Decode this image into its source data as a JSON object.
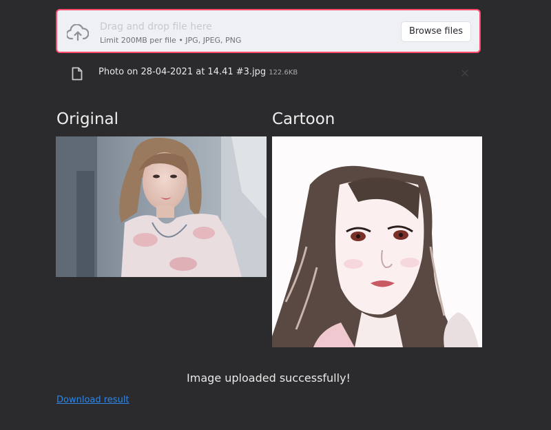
{
  "uploader": {
    "title": "Drag and drop file here",
    "limit_text": "Limit 200MB per file • JPG, JPEG, PNG",
    "browse_label": "Browse files",
    "icon": "cloud-upload-icon",
    "accent_color": "#ff4b6e"
  },
  "uploaded_file": {
    "name": "Photo on 28-04-2021 at 14.41 #3.jpg",
    "size": "122.6KB",
    "icon": "file-icon",
    "remove_icon": "close-icon"
  },
  "columns": {
    "original_heading": "Original",
    "cartoon_heading": "Cartoon"
  },
  "status_message": "Image uploaded successfully!",
  "download_link_label": "Download result",
  "colors": {
    "background": "#2b2b2d",
    "link": "#2f86e8"
  }
}
